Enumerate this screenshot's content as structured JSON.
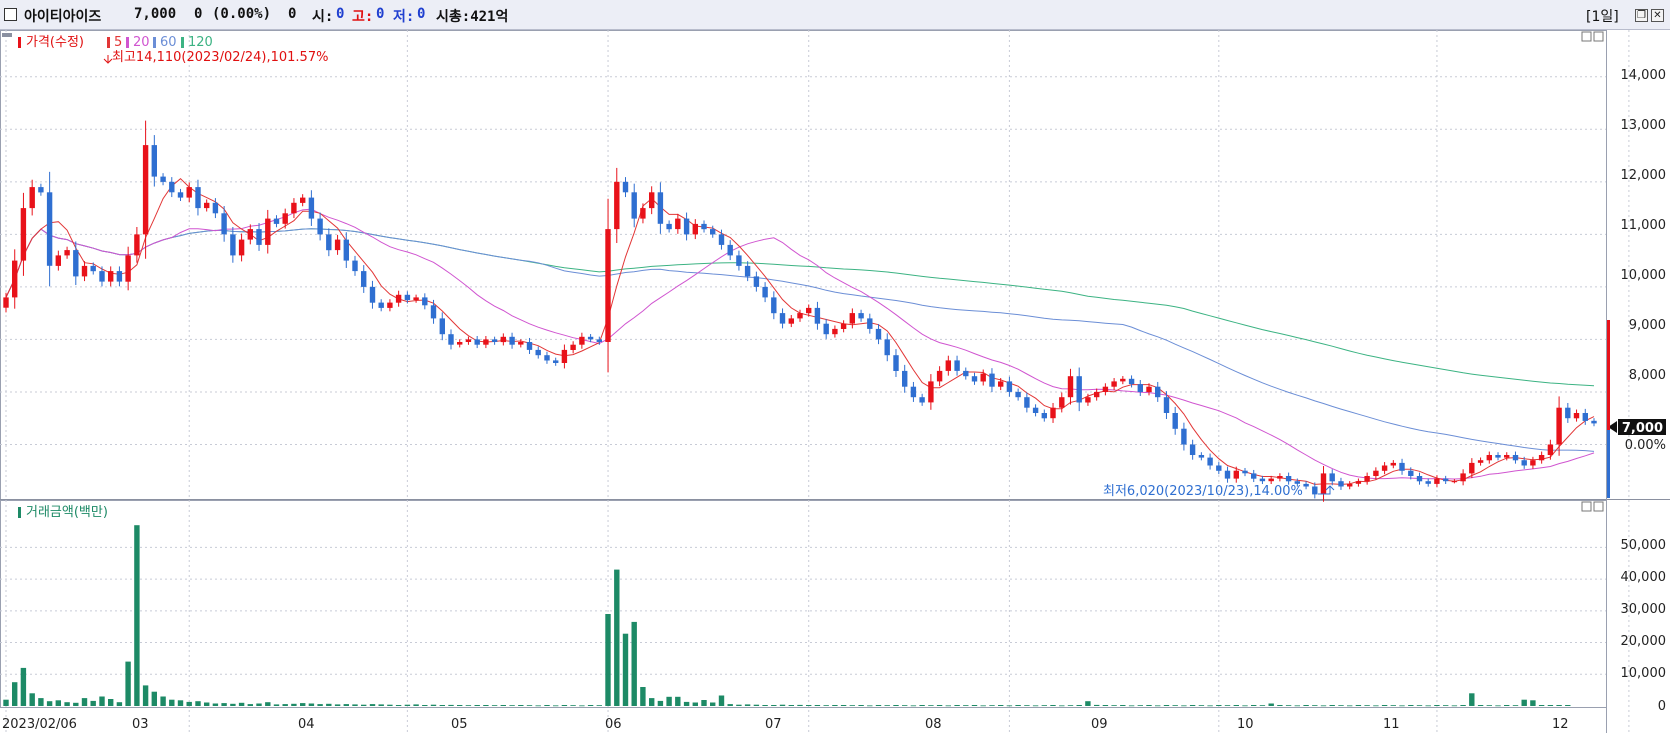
{
  "title_bar": {
    "checkbox": "",
    "stock_name": "아이티아이즈",
    "price": "7,000",
    "change": "0",
    "change_pct": "(0.00%)",
    "volume": "0",
    "open_label": "시:",
    "open_value": "0",
    "high_label": "고:",
    "high_value": "0",
    "low_label": "저:",
    "low_value": "0",
    "mktcap": "시총:421억",
    "period": "[1일]",
    "restore_icon": "restore-icon",
    "close_icon": "close-icon"
  },
  "colors": {
    "up": "#e8121a",
    "down": "#2f6fd1",
    "ma5": "#e23636",
    "ma20": "#d055d0",
    "ma60": "#6b8ed6",
    "ma120": "#3cb383",
    "volume": "#1d8a66",
    "price_box": "#111111"
  },
  "chart_data": [
    {
      "type": "candlestick",
      "title": "가격(수정)",
      "legend": [
        {
          "name": "5",
          "color": "#e23636"
        },
        {
          "name": "20",
          "color": "#d055d0"
        },
        {
          "name": "60",
          "color": "#6b8ed6"
        },
        {
          "name": "120",
          "color": "#3cb383"
        }
      ],
      "y_ticks": [
        "14,000",
        "13,000",
        "12,000",
        "11,000",
        "10,000",
        "9,000",
        "8,000"
      ],
      "ylim": [
        6000,
        14700
      ],
      "x_ticks": [
        "2023/02/06",
        "03",
        "04",
        "05",
        "06",
        "07",
        "08",
        "09",
        "10",
        "11",
        "12"
      ],
      "current_price": "7,000",
      "current_change": "0.00%",
      "annotations": {
        "high": "최고14,110(2023/02/24),101.57%",
        "low": "최저6,020(2023/10/23),14.00%"
      },
      "close": [
        9800,
        10500,
        11500,
        11900,
        11800,
        10400,
        10600,
        10700,
        10200,
        10400,
        10300,
        10100,
        10300,
        10100,
        10600,
        11000,
        12700,
        12100,
        12000,
        11800,
        11700,
        11900,
        11500,
        11600,
        11400,
        11000,
        10600,
        10900,
        11100,
        10800,
        11300,
        11200,
        11400,
        11600,
        11700,
        11300,
        11000,
        10700,
        10900,
        10500,
        10300,
        10000,
        9700,
        9600,
        9700,
        9850,
        9750,
        9800,
        9650,
        9400,
        9100,
        8900,
        8950,
        9000,
        8900,
        9000,
        8950,
        9050,
        8900,
        8950,
        8800,
        8700,
        8600,
        8550,
        8800,
        8900,
        9050,
        9000,
        8950,
        11100,
        12000,
        11800,
        11300,
        11500,
        11800,
        11200,
        11100,
        11300,
        11000,
        11200,
        11100,
        11000,
        10800,
        10600,
        10400,
        10200,
        10000,
        9800,
        9500,
        9300,
        9400,
        9500,
        9600,
        9300,
        9100,
        9200,
        9300,
        9500,
        9400,
        9200,
        9000,
        8700,
        8400,
        8100,
        7900,
        7800,
        8200,
        8400,
        8600,
        8400,
        8300,
        8200,
        8350,
        8100,
        8200,
        8000,
        7900,
        7700,
        7600,
        7500,
        7700,
        7900,
        8300,
        7800,
        7900,
        8000,
        8100,
        8200,
        8250,
        8150,
        8000,
        8100,
        7900,
        7600,
        7300,
        7000,
        6800,
        6750,
        6600,
        6500,
        6350,
        6500,
        6450,
        6350,
        6300,
        6350,
        6400,
        6300,
        6250,
        6200,
        6050,
        6450,
        6300,
        6200,
        6250,
        6300,
        6400,
        6500,
        6600,
        6650,
        6500,
        6400,
        6300,
        6250,
        6350,
        6300,
        6300,
        6450,
        6650,
        6700,
        6800,
        6750,
        6800,
        6700,
        6600,
        6700,
        6800,
        7000,
        7700,
        7500,
        7600,
        7450,
        7400
      ]
    },
    {
      "type": "bar",
      "title": "거래금액(백만)",
      "y_ticks": [
        "50,000",
        "40,000",
        "30,000",
        "20,000",
        "10,000",
        "0"
      ],
      "ylim": [
        0,
        58000
      ],
      "values": [
        2000,
        7500,
        12000,
        4000,
        2500,
        1500,
        1800,
        1200,
        1000,
        2500,
        1600,
        3000,
        2200,
        1200,
        14000,
        57000,
        6500,
        4500,
        3000,
        2000,
        1800,
        1300,
        1500,
        1100,
        800,
        900,
        700,
        1000,
        600,
        800,
        1200,
        500,
        600,
        700,
        900,
        800,
        600,
        700,
        500,
        600,
        500,
        400,
        600,
        500,
        400,
        300,
        400,
        500,
        300,
        400,
        300,
        350,
        300,
        250,
        300,
        300,
        250,
        300,
        250,
        300,
        250,
        200,
        300,
        200,
        300,
        250,
        200,
        300,
        250,
        29000,
        43000,
        22800,
        26500,
        6000,
        2500,
        1600,
        2900,
        2900,
        1300,
        1100,
        1900,
        1100,
        3300,
        600,
        400,
        500,
        400,
        300,
        300,
        400,
        300,
        350,
        300,
        300,
        250,
        300,
        300,
        250,
        300,
        200,
        300,
        250,
        300,
        250,
        200,
        300,
        250,
        300,
        200,
        300,
        250,
        300,
        200,
        250,
        300,
        200,
        300,
        250,
        200,
        250,
        300,
        200,
        250,
        300,
        1500,
        350,
        300,
        250,
        300,
        200,
        250,
        300,
        200,
        300,
        250,
        200,
        300,
        250,
        200,
        300,
        250,
        300,
        200,
        300,
        250,
        800,
        300,
        250,
        200,
        300,
        250,
        200,
        300,
        250,
        200,
        300,
        250,
        200,
        300,
        250,
        200,
        300,
        250,
        200,
        300,
        250,
        200,
        300,
        4000,
        300,
        250,
        200,
        300,
        250,
        2000,
        1800,
        300,
        300,
        300,
        300
      ]
    }
  ]
}
